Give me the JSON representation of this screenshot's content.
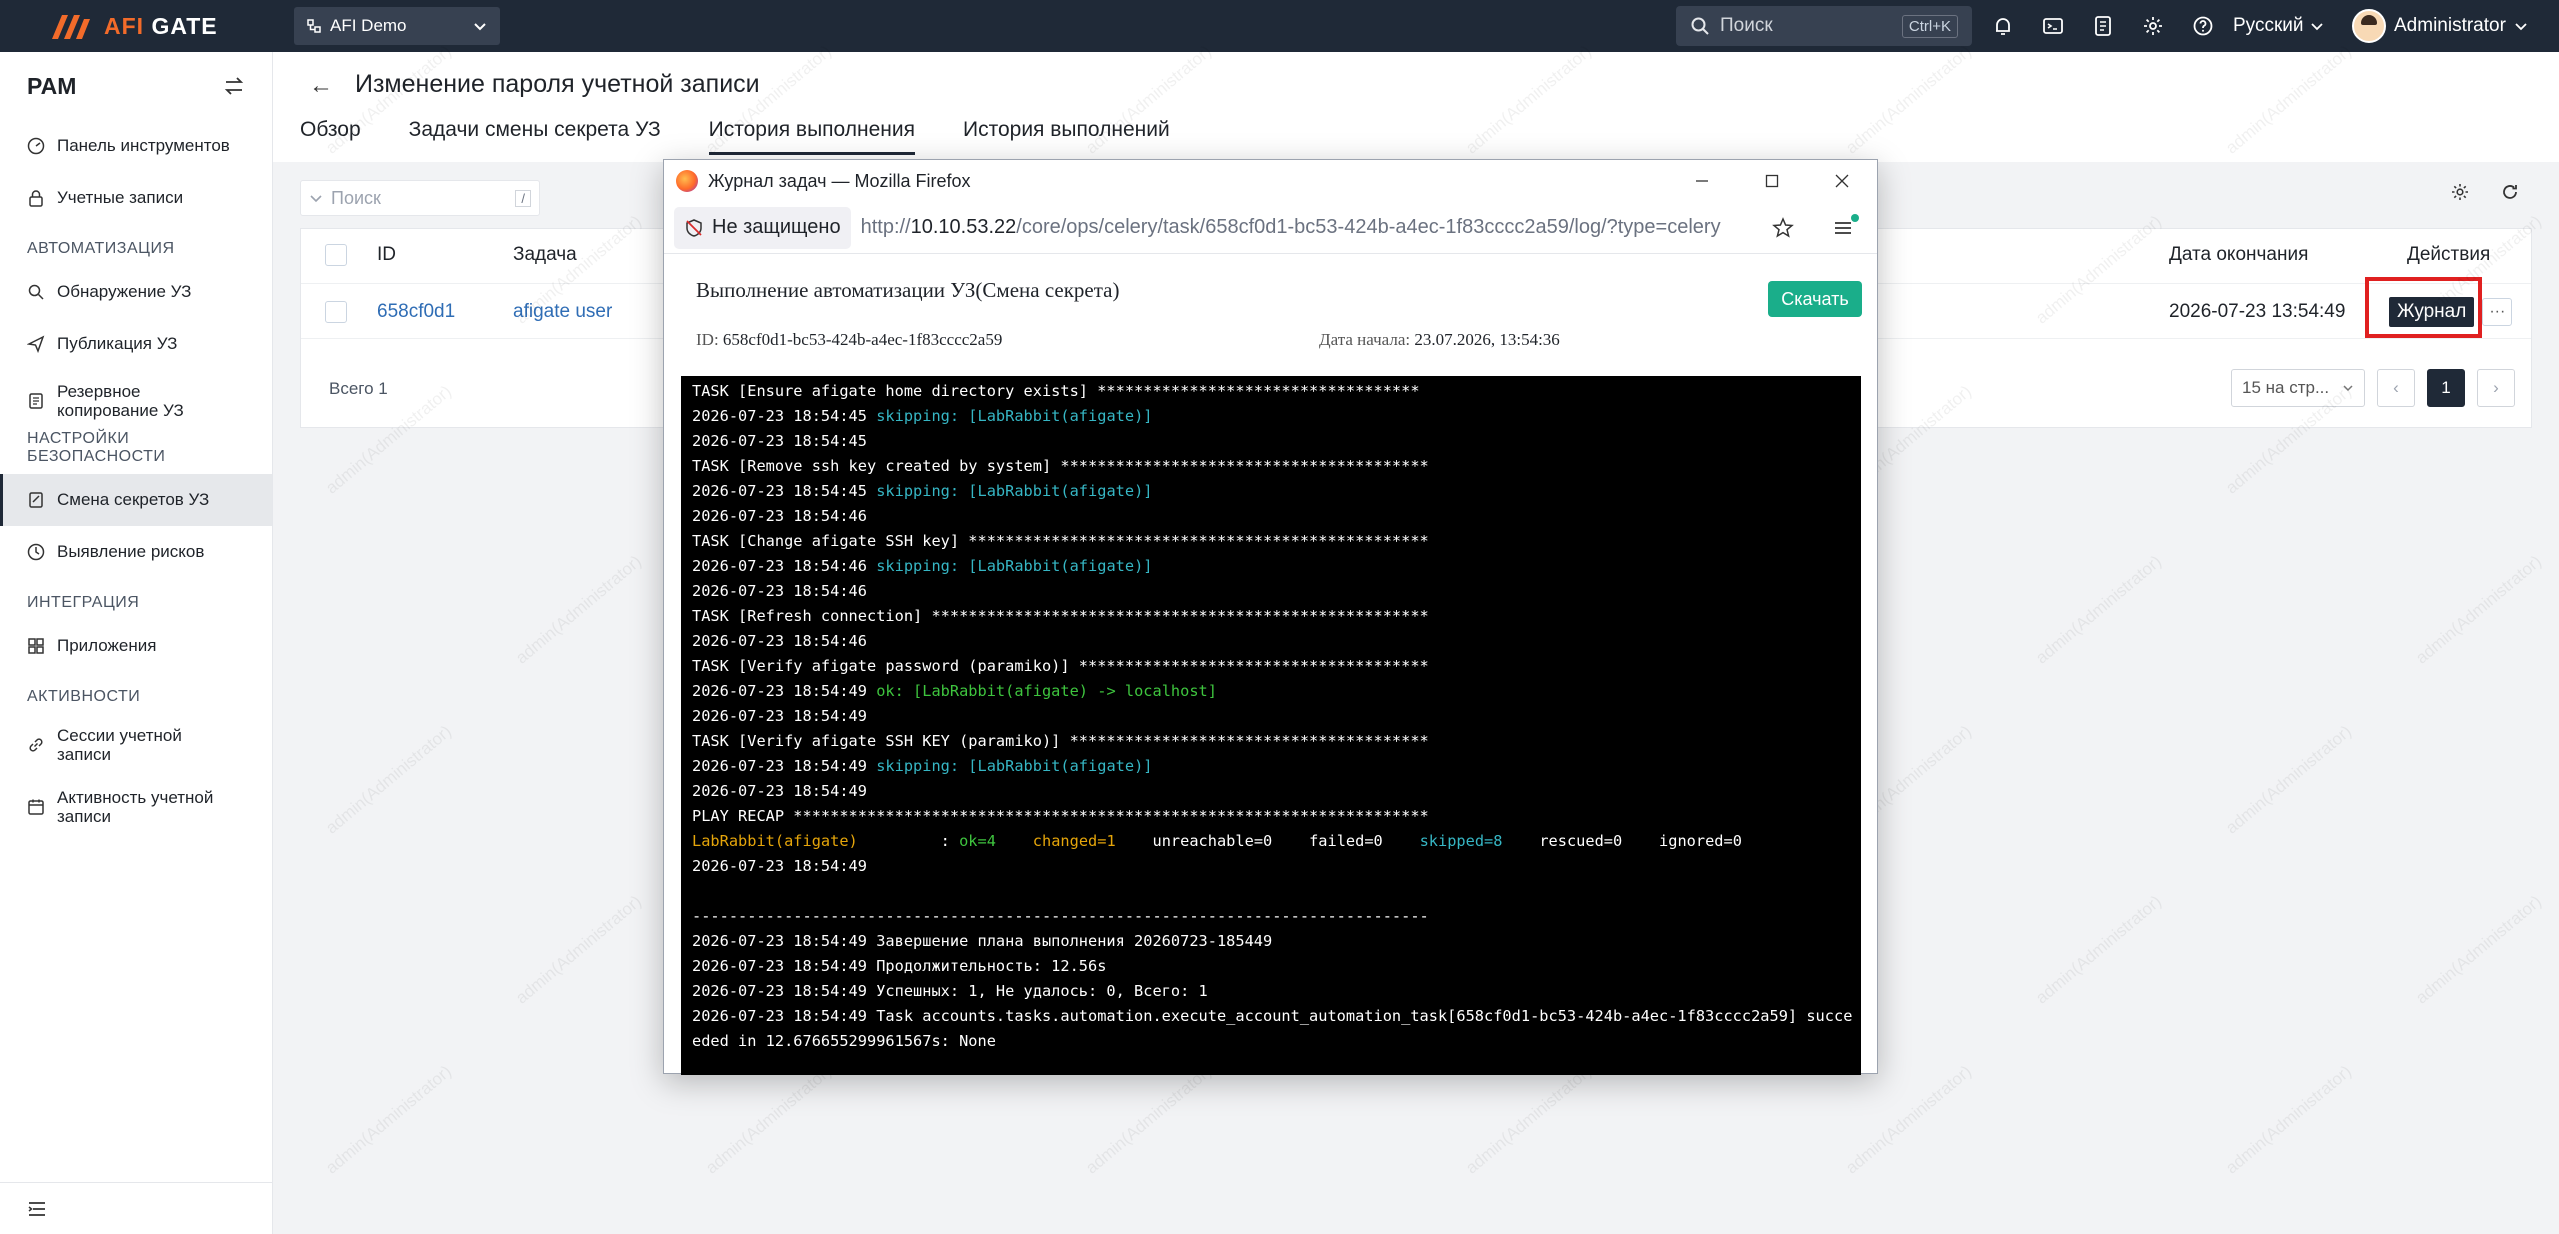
{
  "topbar": {
    "logo_text_a": "AFI",
    "logo_text_b": " GATE",
    "org": "AFI Demo",
    "search_placeholder": "Поиск",
    "search_shortcut": "Ctrl+K",
    "language": "Русский",
    "user": "Administrator",
    "icons": [
      "bell-icon",
      "terminal-icon",
      "document-icon",
      "gear-icon",
      "help-icon"
    ]
  },
  "sidebar": {
    "title": "PAM",
    "items": [
      {
        "type": "item",
        "label": "Панель инструментов",
        "icon": "dashboard-icon"
      },
      {
        "type": "item",
        "label": "Учетные записи",
        "icon": "lock-icon"
      },
      {
        "type": "section",
        "label": "АВТОМАТИЗАЦИЯ"
      },
      {
        "type": "item",
        "label": "Обнаружение УЗ",
        "icon": "search-icon"
      },
      {
        "type": "item",
        "label": "Публикация УЗ",
        "icon": "send-icon"
      },
      {
        "type": "item",
        "label": "Резервное копирование УЗ",
        "icon": "backup-icon"
      },
      {
        "type": "section",
        "label": "НАСТРОЙКИ БЕЗОПАСНОСТИ"
      },
      {
        "type": "item",
        "label": "Смена секретов УЗ",
        "icon": "key-icon",
        "active": true
      },
      {
        "type": "item",
        "label": "Выявление рисков",
        "icon": "risk-icon"
      },
      {
        "type": "section",
        "label": "ИНТЕГРАЦИЯ"
      },
      {
        "type": "item",
        "label": "Приложения",
        "icon": "apps-icon"
      },
      {
        "type": "section",
        "label": "АКТИВНОСТИ"
      },
      {
        "type": "item",
        "label": "Сессии учетной записи",
        "icon": "link-icon"
      },
      {
        "type": "item",
        "label": "Активность учетной записи",
        "icon": "calendar-icon"
      }
    ]
  },
  "header": {
    "title": "Изменение пароля учетной записи",
    "tabs": [
      "Обзор",
      "Задачи смены секрета УЗ",
      "История выполнения",
      "История выполнений"
    ],
    "active_tab": 2
  },
  "table": {
    "search_placeholder": "Поиск",
    "search_key": "/",
    "columns": {
      "id": "ID",
      "task": "Задача",
      "end_date": "Дата окончания",
      "actions": "Действия"
    },
    "rows": [
      {
        "id": "658cf0d1",
        "task": "afigate user",
        "end_date": "2026-07-23 13:54:49",
        "action": "Журнал",
        "more": "···"
      }
    ],
    "total": "Всего 1",
    "per_page": "15 на стр...",
    "page": "1"
  },
  "popup": {
    "window_title": "Журнал задач — Mozilla Firefox",
    "security_label": "Не защищено",
    "url_prefix": "http://",
    "url_host": "10.10.53.22",
    "url_path": "/core/ops/celery/task/658cf0d1-bc53-424b-a4ec-1f83cccc2a59/log/?type=celery",
    "heading": "Выполнение автоматизации УЗ(Смена секрета)",
    "download": "Скачать",
    "id_label": "ID:",
    "id_value": "658cf0d1-bc53-424b-a4ec-1f83cccc2a59",
    "start_label": "Дата начала:",
    "start_value": "23.07.2026, 13:54:36",
    "log": [
      [
        {
          "t": "TASK [Ensure afigate home directory exists] ***********************************"
        }
      ],
      [
        {
          "t": "2026-07-23 18:54:45 "
        },
        {
          "t": "skipping: [LabRabbit(afigate)]",
          "c": "c-cyan"
        }
      ],
      [
        {
          "t": "2026-07-23 18:54:45"
        }
      ],
      [
        {
          "t": "TASK [Remove ssh key created by system] ****************************************"
        }
      ],
      [
        {
          "t": "2026-07-23 18:54:45 "
        },
        {
          "t": "skipping: [LabRabbit(afigate)]",
          "c": "c-cyan"
        }
      ],
      [
        {
          "t": "2026-07-23 18:54:46"
        }
      ],
      [
        {
          "t": "TASK [Change afigate SSH key] **************************************************"
        }
      ],
      [
        {
          "t": "2026-07-23 18:54:46 "
        },
        {
          "t": "skipping: [LabRabbit(afigate)]",
          "c": "c-cyan"
        }
      ],
      [
        {
          "t": "2026-07-23 18:54:46"
        }
      ],
      [
        {
          "t": "TASK [Refresh connection] ******************************************************"
        }
      ],
      [
        {
          "t": "2026-07-23 18:54:46"
        }
      ],
      [
        {
          "t": "TASK [Verify afigate password (paramiko)] **************************************"
        }
      ],
      [
        {
          "t": "2026-07-23 18:54:49 "
        },
        {
          "t": "ok: [LabRabbit(afigate) -> localhost]",
          "c": "c-green"
        }
      ],
      [
        {
          "t": "2026-07-23 18:54:49"
        }
      ],
      [
        {
          "t": "TASK [Verify afigate SSH KEY (paramiko)] ***************************************"
        }
      ],
      [
        {
          "t": "2026-07-23 18:54:49 "
        },
        {
          "t": "skipping: [LabRabbit(afigate)]",
          "c": "c-cyan"
        }
      ],
      [
        {
          "t": "2026-07-23 18:54:49"
        }
      ],
      [
        {
          "t": "PLAY RECAP *********************************************************************"
        }
      ],
      [
        {
          "t": "LabRabbit(afigate)",
          "c": "c-orange"
        },
        {
          "t": "         : "
        },
        {
          "t": "ok=4",
          "c": "c-green"
        },
        {
          "t": "    "
        },
        {
          "t": "changed=1",
          "c": "c-orange"
        },
        {
          "t": "    unreachable=0    failed=0    "
        },
        {
          "t": "skipped=8",
          "c": "c-cyan"
        },
        {
          "t": "    rescued=0    ignored=0"
        }
      ],
      [
        {
          "t": "2026-07-23 18:54:49"
        }
      ],
      [
        {
          "t": ""
        }
      ],
      [
        {
          "t": "--------------------------------------------------------------------------------"
        }
      ],
      [
        {
          "t": "2026-07-23 18:54:49 Завершение плана выполнения 20260723-185449"
        }
      ],
      [
        {
          "t": "2026-07-23 18:54:49 Продолжительность: 12.56s"
        }
      ],
      [
        {
          "t": "2026-07-23 18:54:49 Успешных: 1, Не удалось: 0, Всего: 1"
        }
      ],
      [
        {
          "t": "2026-07-23 18:54:49 Task accounts.tasks.automation.execute_account_automation_task[658cf0d1-bc53-424b-a4ec-1f83cccc2a59] succe"
        }
      ],
      [
        {
          "t": "eded in 12.676655299961567s: None"
        }
      ]
    ]
  },
  "watermark": "admin(Administrator)",
  "colors": {
    "topbar": "#1f2937",
    "accent": "#f26b2a",
    "download": "#1aae8a",
    "link": "#2f6db5",
    "highlight": "#e02020"
  }
}
